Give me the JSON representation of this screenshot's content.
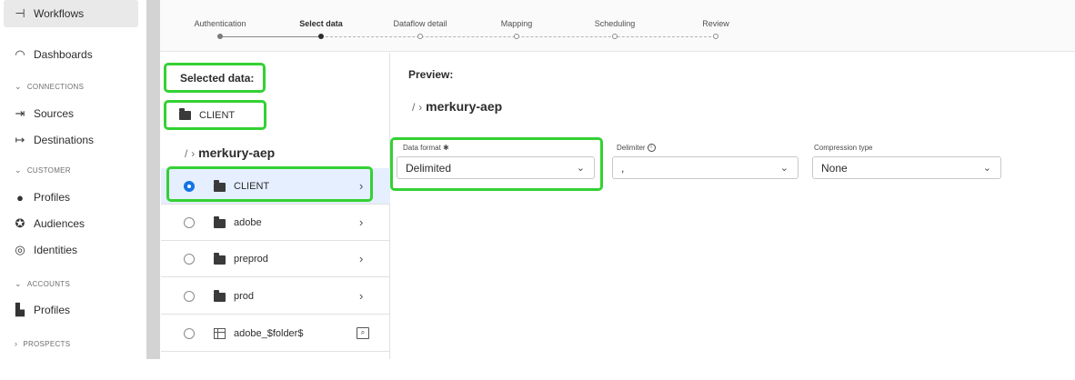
{
  "nav": {
    "workflows": "Workflows",
    "dashboards": "Dashboards",
    "connections_header": "CONNECTIONS",
    "sources": "Sources",
    "destinations": "Destinations",
    "customer_header": "CUSTOMER",
    "profiles": "Profiles",
    "audiences": "Audiences",
    "identities": "Identities",
    "accounts_header": "ACCOUNTS",
    "account_profiles": "Profiles",
    "prospects_header": "PROSPECTS"
  },
  "stepper": {
    "steps": [
      {
        "label": "Authentication",
        "state": "done"
      },
      {
        "label": "Select data",
        "state": "current"
      },
      {
        "label": "Dataflow detail",
        "state": "todo"
      },
      {
        "label": "Mapping",
        "state": "todo"
      },
      {
        "label": "Scheduling",
        "state": "todo"
      },
      {
        "label": "Review",
        "state": "todo"
      }
    ]
  },
  "selected": {
    "title": "Selected data:",
    "item": "CLIENT"
  },
  "browser": {
    "root": "/",
    "sep": "›",
    "bucket": "merkury-aep",
    "rows": [
      {
        "name": "CLIENT",
        "type": "folder",
        "selected": true
      },
      {
        "name": "adobe",
        "type": "folder",
        "selected": false
      },
      {
        "name": "preprod",
        "type": "folder",
        "selected": false
      },
      {
        "name": "prod",
        "type": "folder",
        "selected": false
      },
      {
        "name": "adobe_$folder$",
        "type": "file",
        "selected": false
      }
    ]
  },
  "preview": {
    "title": "Preview:",
    "root": "/",
    "sep": "›",
    "bucket": "merkury-aep"
  },
  "form": {
    "data_format_label": "Data format",
    "required_mark": "✱",
    "data_format_value": "Delimited",
    "delimiter_label": "Delimiter",
    "delimiter_value": ",",
    "compression_label": "Compression type",
    "compression_value": "None"
  },
  "colors": {
    "highlight": "#33d133",
    "accent": "#1473e6",
    "selected_row": "#e5efff"
  }
}
